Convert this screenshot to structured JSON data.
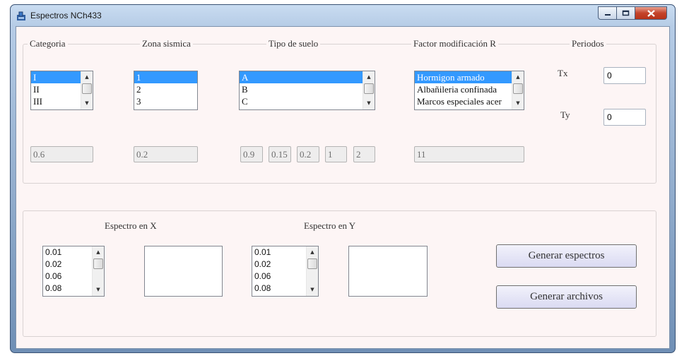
{
  "window": {
    "title": "Espectros NCh433"
  },
  "group1": {
    "labels": {
      "categoria": "Categoria",
      "zona": "Zona sismica",
      "suelo": "Tipo de suelo",
      "factor": "Factor modificación R",
      "periodos": "Periodos"
    },
    "categoria_items": [
      "I",
      "II",
      "III"
    ],
    "zona_items": [
      "1",
      "2",
      "3"
    ],
    "suelo_items": [
      "A",
      "B",
      "C"
    ],
    "factor_items": [
      "Hormigon armado",
      "Albañileria confinada",
      "Marcos especiales acer"
    ],
    "categoria_value": "0.6",
    "zona_value": "0.2",
    "suelo_values": [
      "0.9",
      "0.15",
      "0.2",
      "1",
      "2"
    ],
    "factor_value": "11",
    "tx_label": "Tx",
    "ty_label": "Ty",
    "tx_value": "0",
    "ty_value": "0"
  },
  "group2": {
    "espectro_x_label": "Espectro en X",
    "espectro_y_label": "Espectro en Y",
    "periods_x": [
      "0.01",
      "0.02",
      "0.06",
      "0.08"
    ],
    "periods_y": [
      "0.01",
      "0.02",
      "0.06",
      "0.08"
    ],
    "generar_espectros": "Generar espectros",
    "generar_archivos": "Generar archivos"
  }
}
